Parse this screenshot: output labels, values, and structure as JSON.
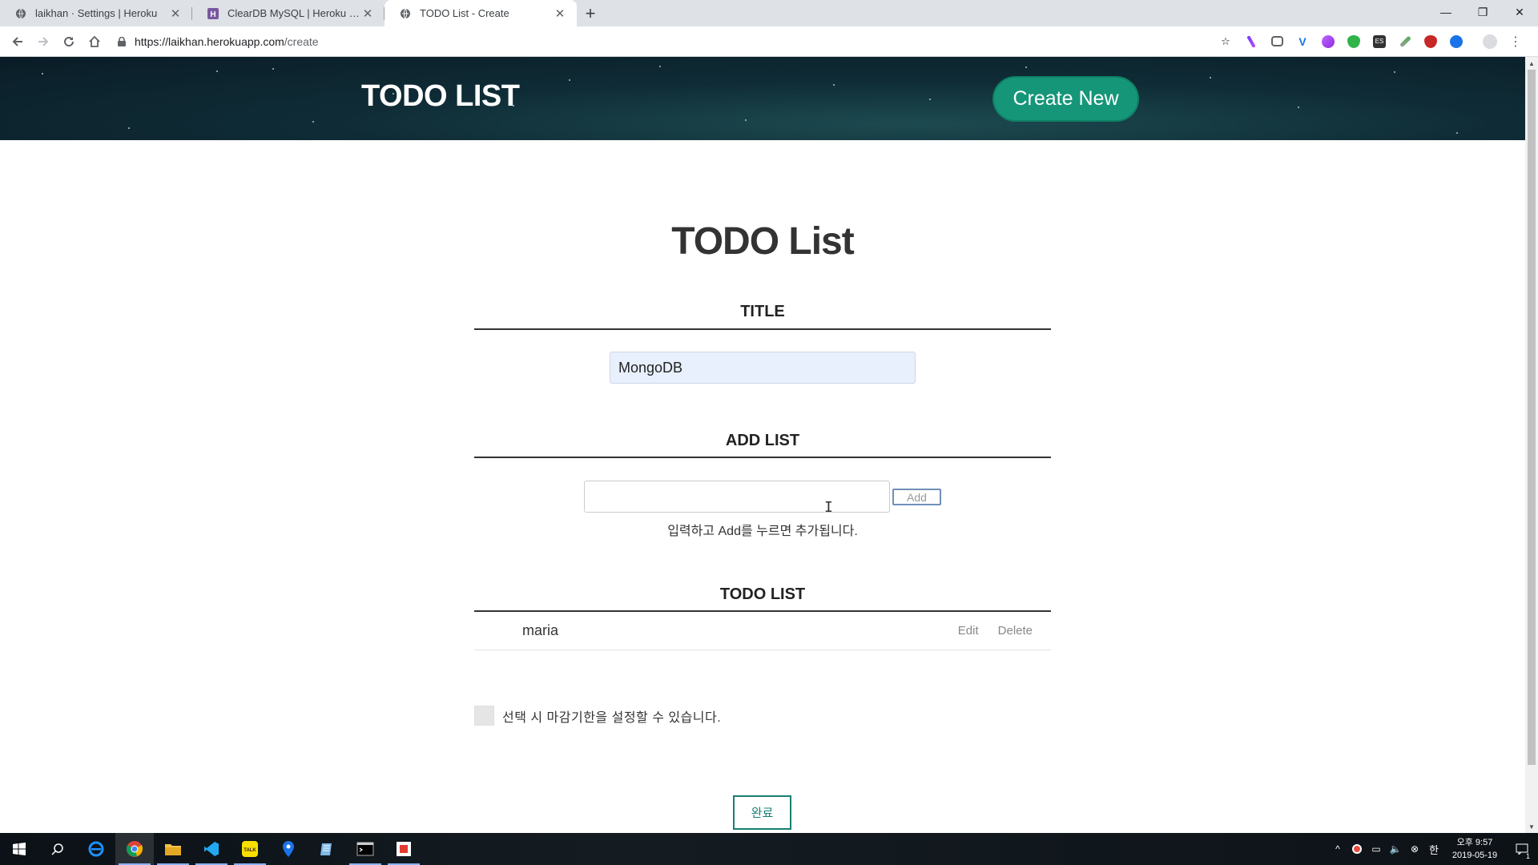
{
  "browser": {
    "tabs": [
      {
        "title": "laikhan · Settings | Heroku",
        "favicon": "heroku-globe-icon",
        "active": false
      },
      {
        "title": "ClearDB MySQL | Heroku Dev C",
        "favicon": "heroku-h-icon",
        "active": false
      },
      {
        "title": "TODO List - Create",
        "favicon": "globe-icon",
        "active": true
      }
    ],
    "url_host": "https://laikhan.herokuapp.com",
    "url_path": "/create",
    "extensions": [
      "pen-icon",
      "pocket-icon",
      "vimeo-icon",
      "paint-icon",
      "shield-icon",
      "es-icon",
      "eyedropper-icon",
      "ublock-icon",
      "translate-icon"
    ]
  },
  "header": {
    "brand": "TODO LIST",
    "create_button": "Create New"
  },
  "main": {
    "heading": "TODO List",
    "title_section": {
      "label": "TITLE",
      "value": "MongoDB"
    },
    "add_section": {
      "label": "ADD LIST",
      "input_value": "",
      "add_button": "Add",
      "hint": "입력하고 Add를 누르면 추가됩니다."
    },
    "list_section": {
      "label": "TODO LIST",
      "items": [
        {
          "text": "maria",
          "edit": "Edit",
          "delete": "Delete"
        }
      ]
    },
    "deadline_checkbox": {
      "checked": false,
      "label": "선택 시 마감기한을 설정할 수 있습니다."
    },
    "done_button": "완료"
  },
  "taskbar": {
    "apps": [
      "windows-start-icon",
      "search-icon",
      "ie-icon",
      "chrome-icon",
      "file-explorer-icon",
      "vscode-icon",
      "kakaotalk-icon",
      "maps-icon",
      "notepad-icon",
      "terminal-icon",
      "office-icon"
    ],
    "clock_time": "오후 9:57",
    "clock_date": "2019-05-19",
    "notification_count": "1"
  },
  "colors": {
    "accent": "#169678",
    "done_border": "#1a7f72",
    "hero_dark": "#0f2c36",
    "input_fill": "#e8f0fe"
  }
}
